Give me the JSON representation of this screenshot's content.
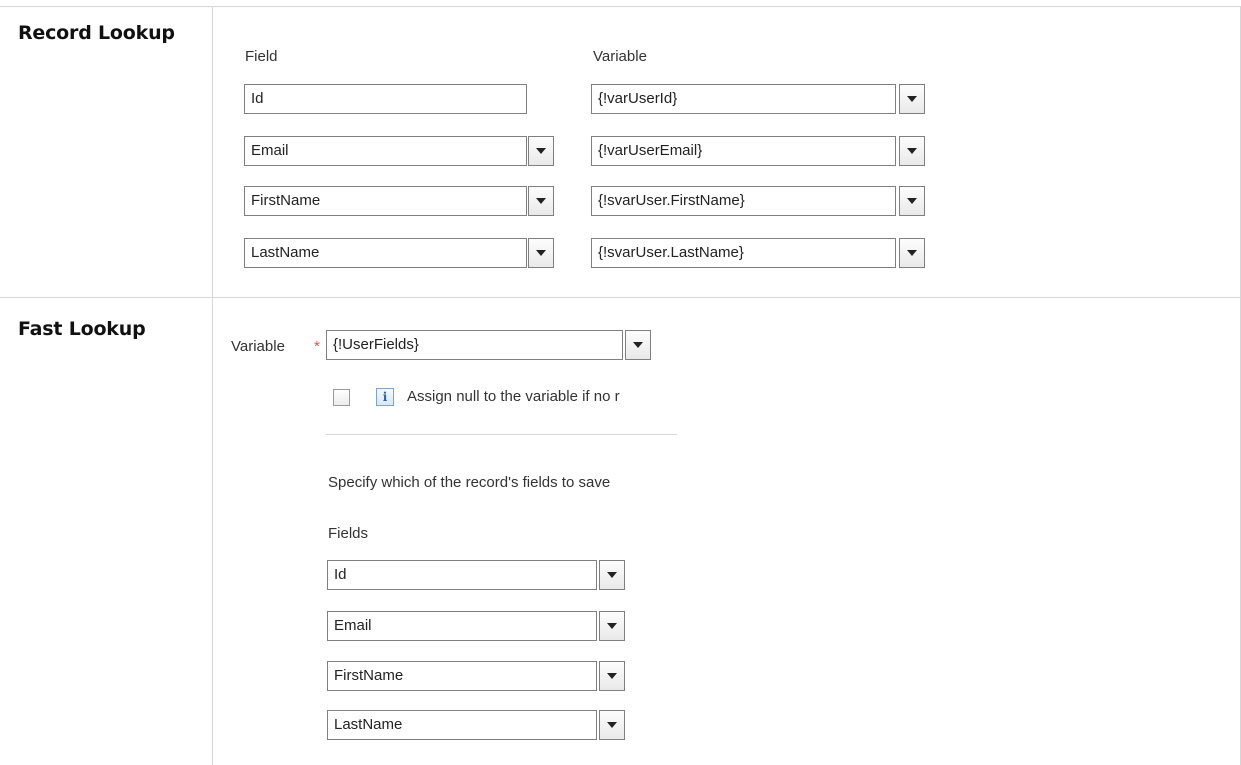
{
  "record_lookup": {
    "title": "Record Lookup",
    "field_header": "Field",
    "variable_header": "Variable",
    "rows": [
      {
        "field": "Id",
        "variable": "{!varUserId}"
      },
      {
        "field": "Email",
        "variable": "{!varUserEmail}"
      },
      {
        "field": "FirstName",
        "variable": "{!svarUser.FirstName}"
      },
      {
        "field": "LastName",
        "variable": "{!svarUser.LastName}"
      }
    ]
  },
  "fast_lookup": {
    "title": "Fast Lookup",
    "variable_label": "Variable",
    "required_mark": "*",
    "variable_value": "{!UserFields}",
    "info_glyph": "i",
    "assign_null_label": "Assign null to the variable if no r",
    "specify_text": "Specify which of the record's fields to save",
    "fields_label": "Fields",
    "fields": [
      "Id",
      "Email",
      "FirstName",
      "LastName"
    ]
  },
  "colors": {
    "grid_line": "#d6d6d6",
    "required": "#d9534f",
    "info_blue": "#2c63a6"
  }
}
